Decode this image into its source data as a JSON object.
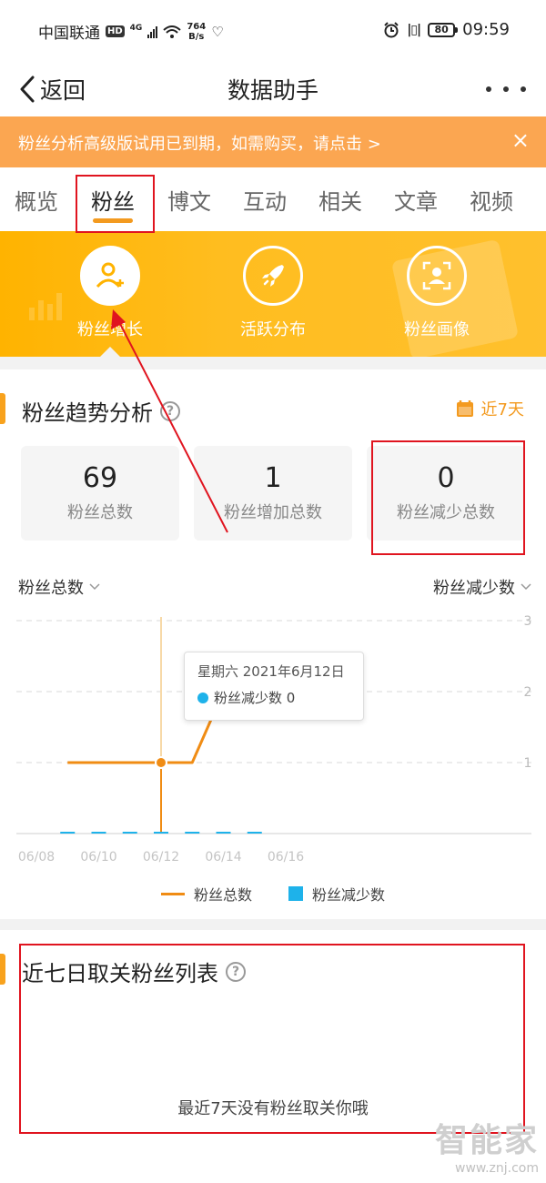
{
  "status_bar": {
    "carrier": "中国联通",
    "hd": "HD",
    "network": "4G",
    "speed_value": "764",
    "speed_unit": "B/s",
    "battery": "80",
    "time": "09:59"
  },
  "nav": {
    "back_label": "返回",
    "title": "数据助手"
  },
  "promo": {
    "text": "粉丝分析高级版试用已到期，如需购买，请点击 >",
    "close": "×"
  },
  "tabs": [
    {
      "label": "概览"
    },
    {
      "label": "粉丝"
    },
    {
      "label": "博文"
    },
    {
      "label": "互动"
    },
    {
      "label": "相关"
    },
    {
      "label": "文章"
    },
    {
      "label": "视频"
    }
  ],
  "active_tab": "粉丝",
  "features": [
    {
      "label": "粉丝增长",
      "icon": "user-plus-icon"
    },
    {
      "label": "活跃分布",
      "icon": "rocket-icon"
    },
    {
      "label": "粉丝画像",
      "icon": "portrait-icon"
    }
  ],
  "trend": {
    "title": "粉丝趋势分析",
    "help": "?",
    "range": "近7天",
    "stats": [
      {
        "value": "69",
        "label": "粉丝总数"
      },
      {
        "value": "1",
        "label": "粉丝增加总数"
      },
      {
        "value": "0",
        "label": "粉丝减少总数"
      }
    ],
    "left_metric": "粉丝总数",
    "right_metric": "粉丝减少数",
    "tooltip": {
      "date": "星期六 2021年6月12日",
      "series": "粉丝减少数 0"
    },
    "legend": {
      "line": "粉丝总数",
      "bar": "粉丝减少数"
    }
  },
  "chart_data": {
    "type": "line",
    "x": [
      "06/08",
      "06/09",
      "06/10",
      "06/11",
      "06/12",
      "06/13",
      "06/14",
      "06/15",
      "06/16"
    ],
    "x_tick_labels": [
      "06/08",
      "06/10",
      "06/12",
      "06/14",
      "06/16"
    ],
    "y_right_ticks": [
      "1",
      "2",
      "3"
    ],
    "ylim": [
      0,
      3
    ],
    "grid": true,
    "legend_position": "bottom",
    "series": [
      {
        "name": "粉丝总数",
        "kind": "line",
        "color": "#f08c14",
        "points": [
          [
            "06/09",
            1
          ],
          [
            "06/10",
            1
          ],
          [
            "06/11",
            1
          ],
          [
            "06/12",
            1
          ],
          [
            "06/13",
            1
          ],
          [
            "06/14",
            2
          ],
          [
            "06/15",
            2
          ]
        ]
      },
      {
        "name": "粉丝减少数",
        "kind": "bar",
        "color": "#1eb2ea",
        "points": [
          [
            "06/09",
            0
          ],
          [
            "06/10",
            0
          ],
          [
            "06/11",
            0
          ],
          [
            "06/12",
            0
          ],
          [
            "06/13",
            0
          ],
          [
            "06/14",
            0
          ],
          [
            "06/15",
            0
          ]
        ]
      }
    ]
  },
  "unfollow": {
    "title": "近七日取关粉丝列表",
    "help": "?",
    "empty": "最近7天没有粉丝取关你哦"
  },
  "watermark": {
    "main": "智能家",
    "url": "www.znj.com"
  },
  "colors": {
    "accent": "#f39a1f",
    "banner": "#fba651",
    "line": "#f08c14",
    "bar": "#1eb2ea",
    "annotation": "#e0141f"
  }
}
